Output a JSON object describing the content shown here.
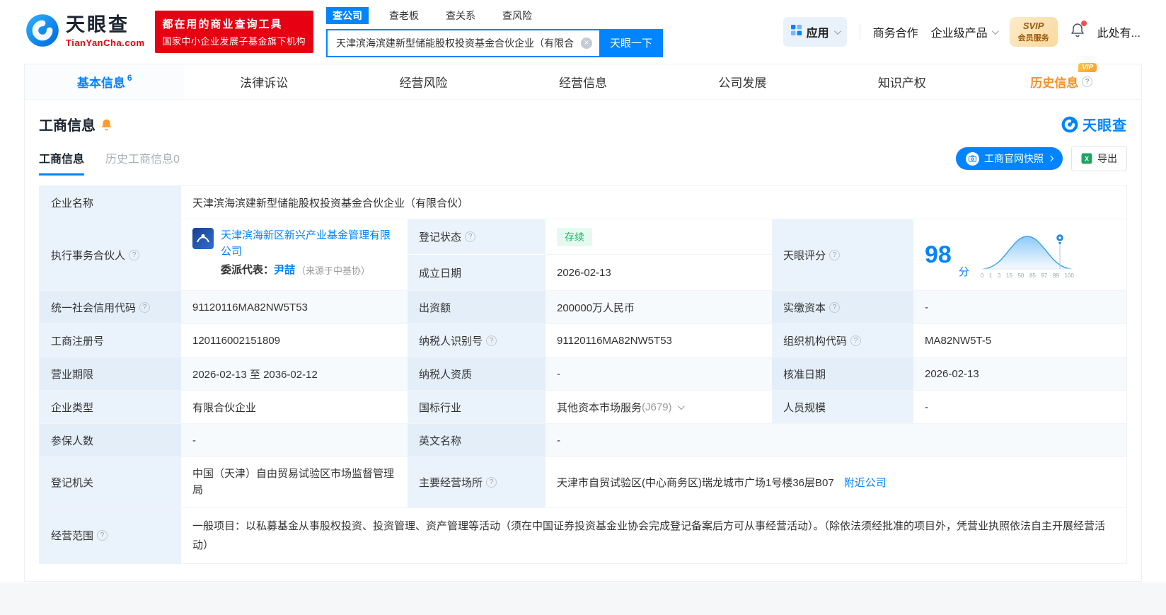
{
  "brand": {
    "name": "天眼查",
    "domain": "TianYanCha.com",
    "slogan_line1": "都在用的商业查询工具",
    "slogan_line2": "国家中小企业发展子基金旗下机构",
    "accent_color": "#0084ff",
    "red_color": "#e60012"
  },
  "search": {
    "tabs": [
      {
        "label": "查公司",
        "active": true
      },
      {
        "label": "查老板",
        "active": false
      },
      {
        "label": "查关系",
        "active": false
      },
      {
        "label": "查风险",
        "active": false
      }
    ],
    "value": "天津滨海滨建新型储能股权投资基金合伙企业（有限合",
    "button": "天眼一下"
  },
  "topnav": {
    "apps": "应用",
    "cooperation": "商务合作",
    "enterprise": "企业级产品",
    "svip_top": "SVIP",
    "svip_bottom": "会员服务",
    "user": "此处有..."
  },
  "tabs": [
    {
      "label": "基本信息",
      "badge": "6"
    },
    {
      "label": "法律诉讼"
    },
    {
      "label": "经营风险"
    },
    {
      "label": "经营信息"
    },
    {
      "label": "公司发展"
    },
    {
      "label": "知识产权"
    },
    {
      "label": "历史信息",
      "vip": "VIP"
    }
  ],
  "section": {
    "title": "工商信息",
    "logo_text": "天眼查",
    "subtab_active": "工商信息",
    "subtab_history": "历史工商信息0",
    "snapshot_button": "工商官网快照",
    "export_button": "导出"
  },
  "table": {
    "company_name": {
      "label": "企业名称",
      "value": "天津滨海滨建新型储能股权投资基金合伙企业（有限合伙）"
    },
    "partner": {
      "label": "执行事务合伙人",
      "company": "天津滨海新区新兴产业基金管理有限公司",
      "rep_label": "委派代表：",
      "rep_name": "尹喆",
      "rep_source": "（来源于中基协）"
    },
    "reg_status": {
      "label": "登记状态",
      "value": "存续"
    },
    "establish_date": {
      "label": "成立日期",
      "value": "2026-02-13"
    },
    "score": {
      "label": "天眼评分",
      "value": "98",
      "unit": "分",
      "axis": [
        "0",
        "1",
        "3",
        "15",
        "50",
        "85",
        "97",
        "99",
        "100"
      ]
    },
    "credit_code": {
      "label": "统一社会信用代码",
      "value": "91120116MA82NW5T53"
    },
    "capital": {
      "label": "出资额",
      "value": "200000万人民币"
    },
    "paid_capital": {
      "label": "实缴资本",
      "value": "-"
    },
    "reg_number": {
      "label": "工商注册号",
      "value": "120116002151809"
    },
    "taxpayer_id": {
      "label": "纳税人识别号",
      "value": "91120116MA82NW5T53"
    },
    "org_code": {
      "label": "组织机构代码",
      "value": "MA82NW5T-5"
    },
    "business_term": {
      "label": "营业期限",
      "value": "2026-02-13 至 2036-02-12"
    },
    "taxpayer_quality": {
      "label": "纳税人资质",
      "value": "-"
    },
    "approval_date": {
      "label": "核准日期",
      "value": "2026-02-13"
    },
    "company_type": {
      "label": "企业类型",
      "value": "有限合伙企业"
    },
    "industry": {
      "label": "国标行业",
      "value": "其他资本市场服务",
      "code": "(J679)"
    },
    "staff_size": {
      "label": "人员规模",
      "value": "-"
    },
    "insured_count": {
      "label": "参保人数",
      "value": "-"
    },
    "english_name": {
      "label": "英文名称",
      "value": "-"
    },
    "reg_authority": {
      "label": "登记机关",
      "value": "中国（天津）自由贸易试验区市场监督管理局"
    },
    "address": {
      "label": "主要经营场所",
      "value": "天津市自贸试验区(中心商务区)瑞龙城市广场1号楼36层B07",
      "nearby": "附近公司"
    },
    "business_scope": {
      "label": "经营范围",
      "value": "一般项目：以私募基金从事股权投资、投资管理、资产管理等活动（须在中国证券投资基金业协会完成登记备案后方可从事经营活动）。（除依法须经批准的项目外，凭营业执照依法自主开展经营活动）"
    }
  }
}
